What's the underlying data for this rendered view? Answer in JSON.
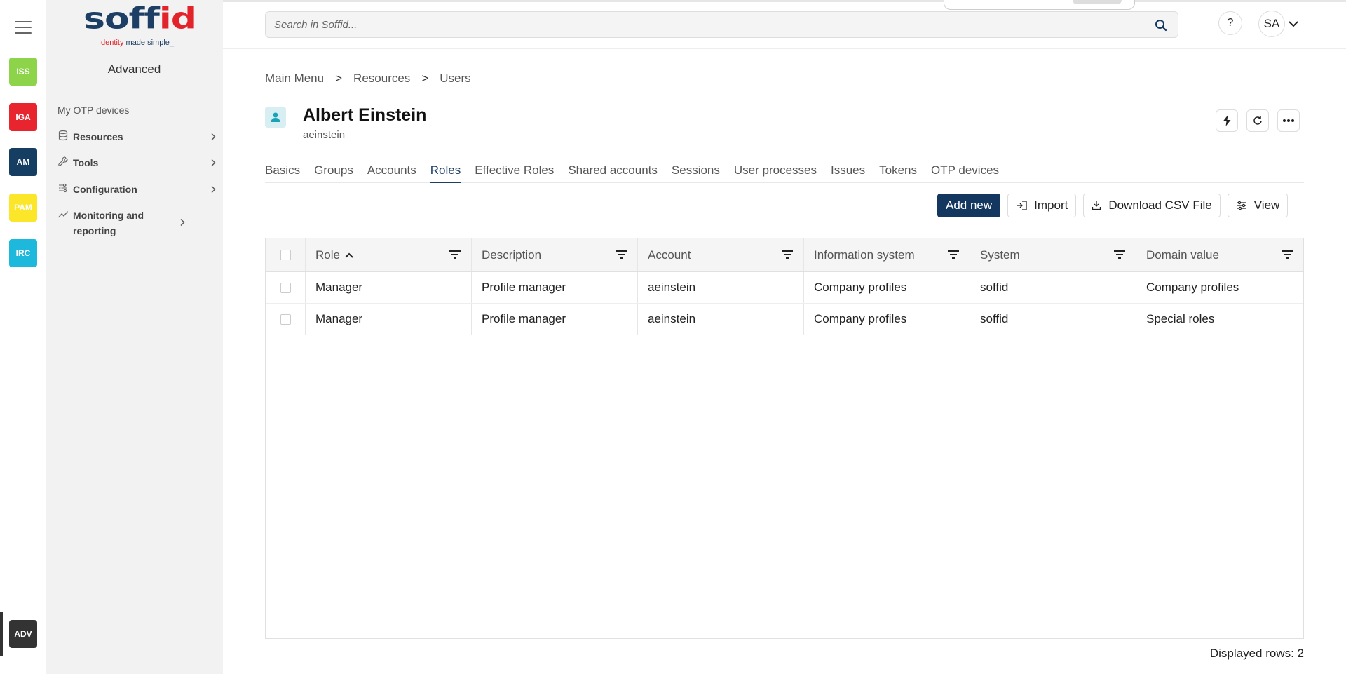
{
  "rail": {
    "apps": [
      {
        "code": "ISS",
        "color": "#8ed44b"
      },
      {
        "code": "IGA",
        "color": "#e8242e"
      },
      {
        "code": "AM",
        "color": "#163e63"
      },
      {
        "code": "PAM",
        "color": "#fbe629"
      },
      {
        "code": "IRC",
        "color": "#1eb8dd"
      }
    ],
    "adv": {
      "code": "ADV",
      "color": "#333333"
    }
  },
  "sidebar": {
    "logo": {
      "word_main": "soff",
      "word_accent": "id",
      "tag_red": "Identity",
      "tag_blue": " made simple_"
    },
    "title": "Advanced",
    "link": "My OTP devices",
    "items": [
      {
        "label": "Resources",
        "icon": "database-icon"
      },
      {
        "label": "Tools",
        "icon": "wrench-icon"
      },
      {
        "label": "Configuration",
        "icon": "sliders-icon"
      },
      {
        "label": "Monitoring and reporting",
        "icon": "chart-line-icon"
      }
    ]
  },
  "topbar": {
    "search_placeholder": "Search in Soffid...",
    "help_label": "?",
    "avatar_initials": "SA"
  },
  "breadcrumb": [
    "Main Menu",
    "Resources",
    "Users"
  ],
  "breadcrumb_sep": ">",
  "user": {
    "name": "Albert Einstein",
    "login": "aeinstein"
  },
  "tabs": [
    "Basics",
    "Groups",
    "Accounts",
    "Roles",
    "Effective Roles",
    "Shared accounts",
    "Sessions",
    "User processes",
    "Issues",
    "Tokens",
    "OTP devices"
  ],
  "active_tab": "Roles",
  "toolbar": {
    "add_new": "Add new",
    "import": "Import",
    "download_csv": "Download CSV File",
    "view": "View"
  },
  "table": {
    "columns": [
      "Role",
      "Description",
      "Account",
      "Information system",
      "System",
      "Domain value"
    ],
    "rows": [
      [
        "Manager",
        "Profile manager",
        "aeinstein",
        "Company profiles",
        "soffid",
        "Company profiles"
      ],
      [
        "Manager",
        "Profile manager",
        "aeinstein",
        "Company profiles",
        "soffid",
        "Special roles"
      ]
    ]
  },
  "footer": {
    "displayed_rows": "Displayed rows: 2"
  }
}
